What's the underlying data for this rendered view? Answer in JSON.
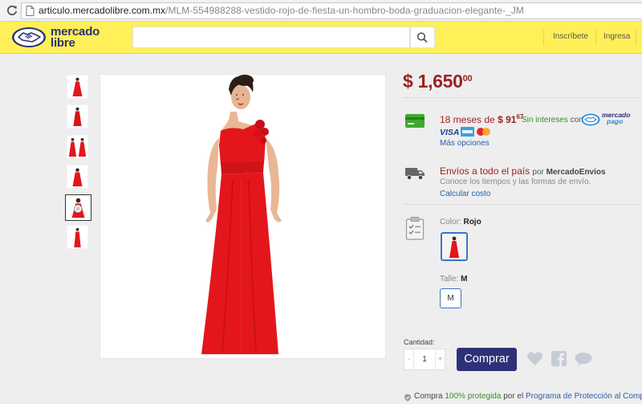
{
  "browser": {
    "url_host": "articulo.mercadolibre.com.mx",
    "url_path": "/MLM-554988288-vestido-rojo-de-fiesta-un-hombro-boda-graduacion-elegante-_JM"
  },
  "header": {
    "logo_line1": "mercado",
    "logo_line2": "libre",
    "search_placeholder": "",
    "nav_signup": "Inscríbete",
    "nav_login": "Ingresa",
    "brand_color": "#fff059",
    "accent_color": "#2d3277"
  },
  "product": {
    "price_currency": "$",
    "price_main": "1,650",
    "price_cents": "00",
    "installments_prefix": "18 meses de",
    "installment_currency": "$",
    "installment_main": "91",
    "installment_cents": "67",
    "no_interest_label": "Sin intereses",
    "no_interest_with": "con",
    "mercadopago_line1": "mercado",
    "mercadopago_line2": "pago",
    "more_options": "Más opciones",
    "card_labels": [
      "VISA",
      "AMEX",
      "MasterCard"
    ],
    "shipping_title": "Envíos a todo el país",
    "shipping_by": "por",
    "shipping_provider": "MercadoEnvios",
    "shipping_note": "Conoce los tiempos y las formas de envío.",
    "calc_cost": "Calcular costo",
    "color_label": "Color:",
    "color_value": "Rojo",
    "size_label": "Talle:",
    "size_value": "M",
    "size_option": "M",
    "quantity_label": "Cantidad:",
    "quantity_minus": "-",
    "quantity_value": "1",
    "quantity_plus": "+",
    "buy_label": "Comprar",
    "dress_color": "#e3161c"
  },
  "protection": {
    "prefix": "Compra",
    "percent": "100% protegida",
    "middle": "por el",
    "program": "Programa de Protección al Comprador"
  }
}
